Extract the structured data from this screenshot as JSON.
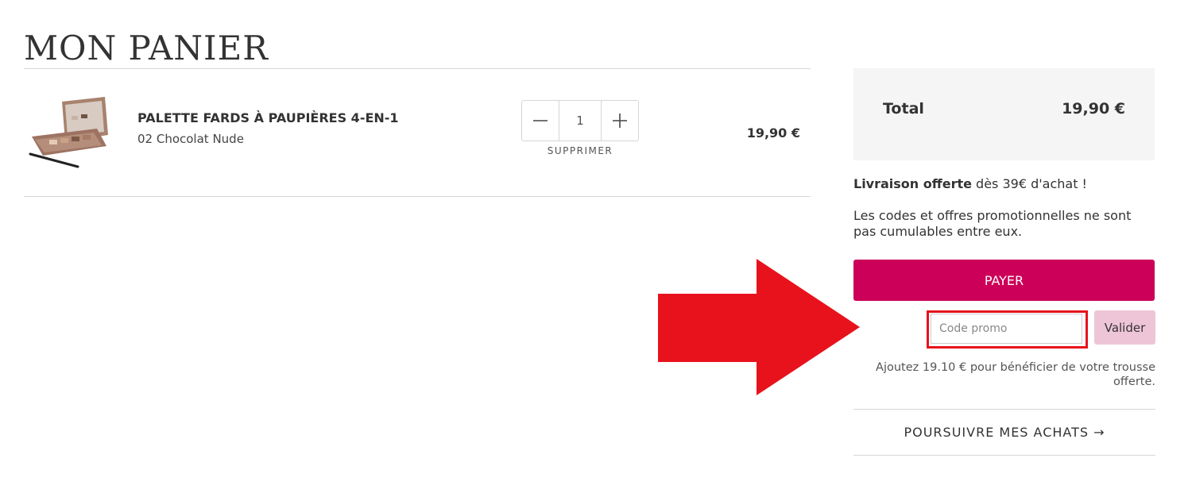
{
  "header": {
    "title": "MON PANIER"
  },
  "cart": {
    "items": [
      {
        "name": "PALETTE FARDS À PAUPIÈRES 4-EN-1",
        "variant": "02 Chocolat Nude",
        "quantity": "1",
        "remove_label": "SUPPRIMER",
        "price": "19,90 €",
        "minus_icon": "minus-icon",
        "plus_icon": "plus-icon"
      }
    ]
  },
  "summary": {
    "total_label": "Total",
    "total_value": "19,90 €",
    "shipping_bold": "Livraison offerte",
    "shipping_rest": " dès 39€ d'achat !",
    "promo_rule": "Les codes et offres promotionnelles ne sont pas cumulables entre eux.",
    "pay_label": "PAYER",
    "promo_placeholder": "Code promo",
    "validate_label": "Valider",
    "gift_note": "Ajoutez 19.10 € pour bénéficier de votre trousse offerte.",
    "continue_label": "POURSUIVRE MES ACHATS →"
  },
  "colors": {
    "pay_button": "#cc0058",
    "validate_button": "#eec5d6",
    "annotation_arrow": "#e8121c",
    "total_box": "#f5f5f5"
  }
}
